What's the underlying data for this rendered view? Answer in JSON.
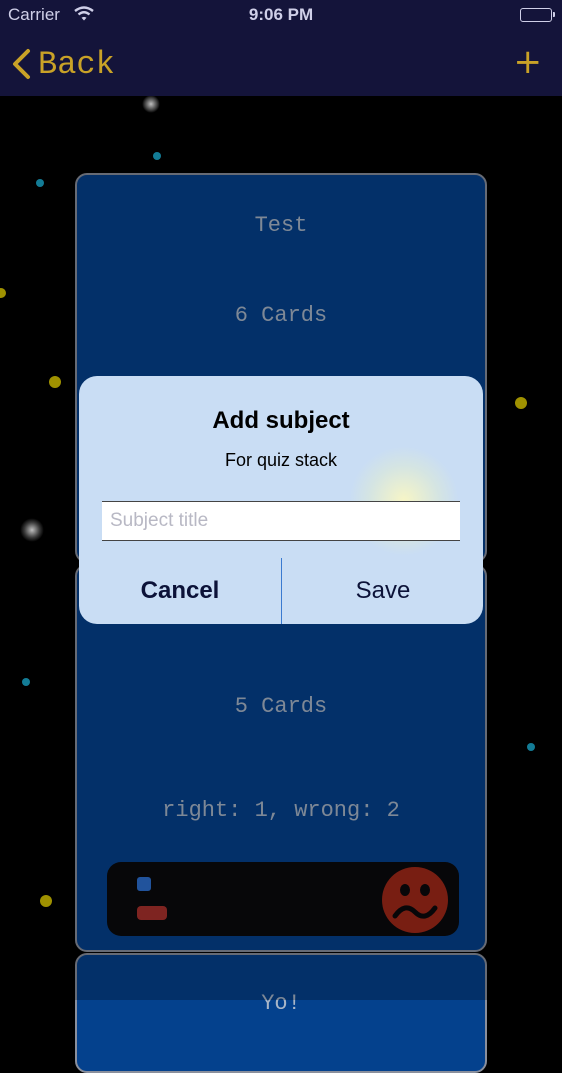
{
  "status_bar": {
    "carrier": "Carrier",
    "time": "9:06 PM"
  },
  "nav": {
    "back_label": "Back",
    "add_label": "+"
  },
  "cards": [
    {
      "title": "Test",
      "count": "6 Cards"
    },
    {
      "title": "",
      "count": "5 Cards",
      "score": "right: 1, wrong: 2"
    },
    {
      "title": "Yo!"
    }
  ],
  "alert": {
    "title": "Add subject",
    "message": "For quiz stack",
    "input_placeholder": "Subject title",
    "input_value": "",
    "cancel_label": "Cancel",
    "save_label": "Save"
  },
  "colors": {
    "accent": "#c9a227",
    "card_background": "#04418d",
    "alert_background": "#c9ddf4"
  }
}
